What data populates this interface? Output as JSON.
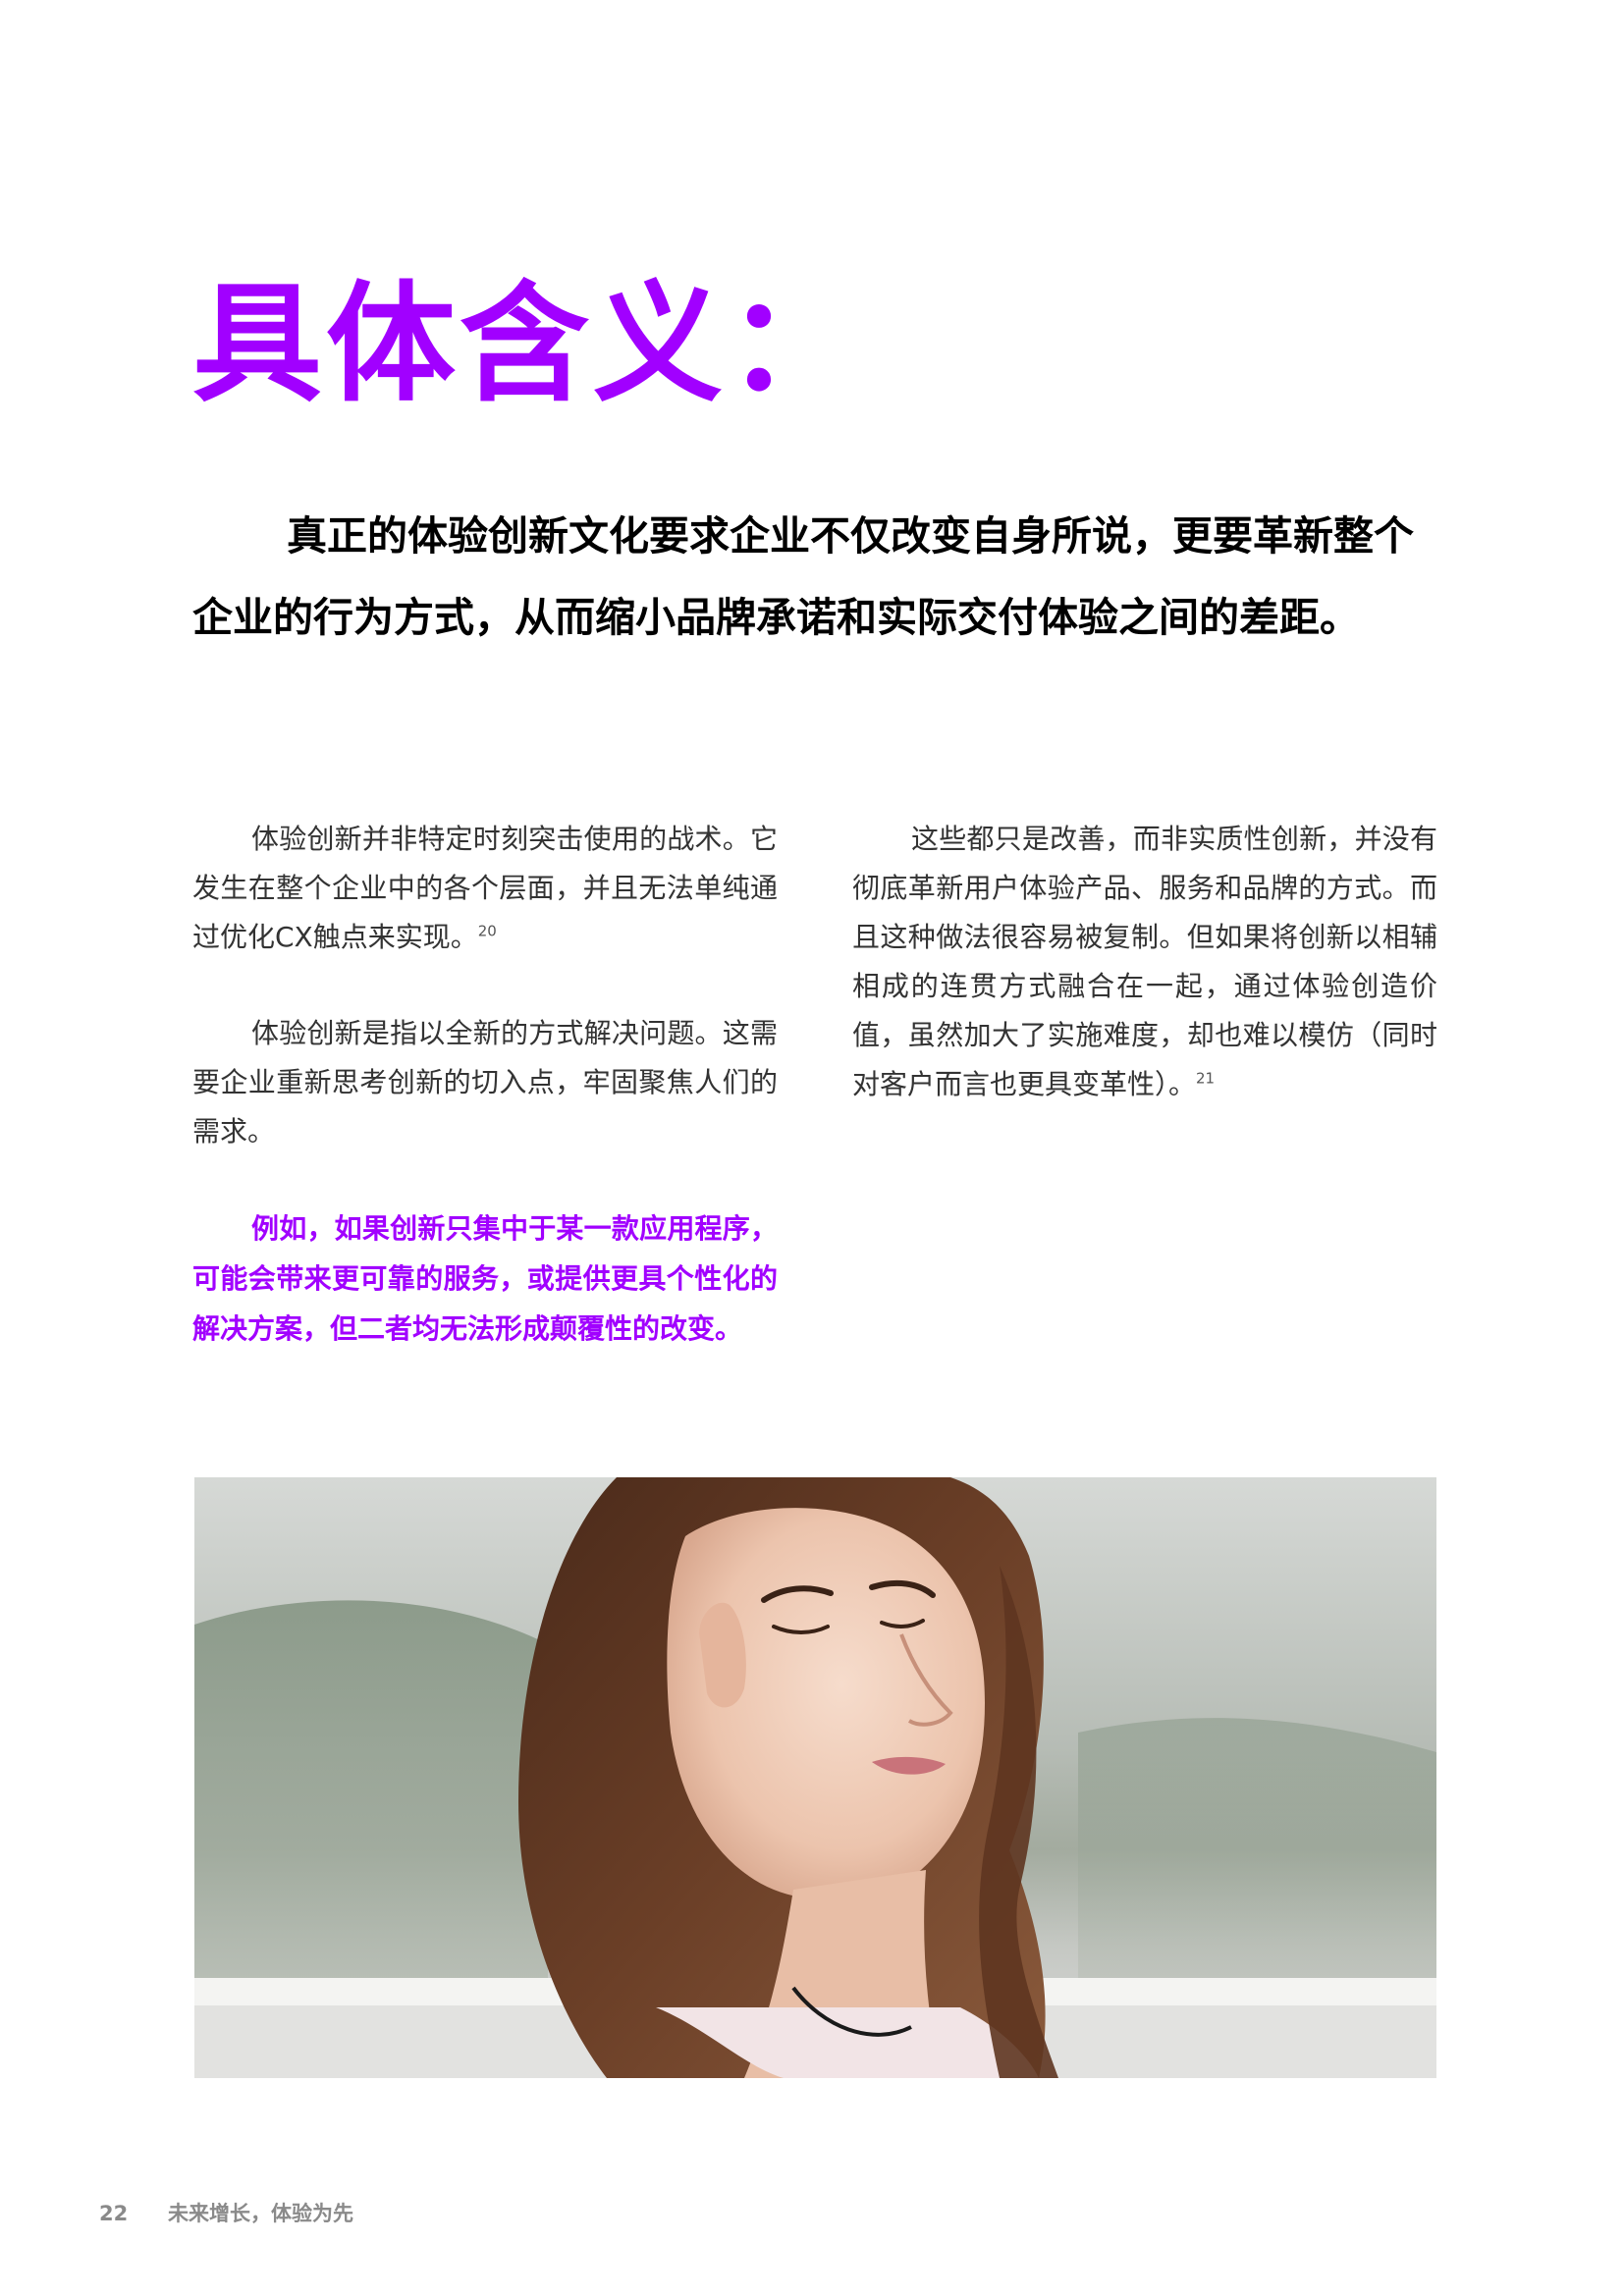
{
  "heading": "具体含义：",
  "lead": "真正的体验创新文化要求企业不仅改变自身所说，更要革新整个企业的行为方式，从而缩小品牌承诺和实际交付体验之间的差距。",
  "left_column": {
    "p1": "体验创新并非特定时刻突击使用的战术。它发生在整个企业中的各个层面，并且无法单纯通过优化CX触点来实现。",
    "p1_ref": "20",
    "p2": "体验创新是指以全新的方式解决问题。这需要企业重新思考创新的切入点，牢固聚焦人们的需求。",
    "callout": "例如，如果创新只集中于某一款应用程序，可能会带来更可靠的服务，或提供更具个性化的解决方案，但二者均无法形成颠覆性的改变。"
  },
  "right_column": {
    "p1": "这些都只是改善，而非实质性创新，并没有彻底革新用户体验产品、服务和品牌的方式。而且这种做法很容易被复制。但如果将创新以相辅相成的连贯方式融合在一起，通过体验创造价值，虽然加大了实施难度，却也难以模仿（同时对客户而言也更具变革性）。",
    "p1_ref": "21"
  },
  "footer": {
    "page_number": "22",
    "title": "未来增长，体验为先"
  },
  "colors": {
    "accent": "#a100ff"
  }
}
